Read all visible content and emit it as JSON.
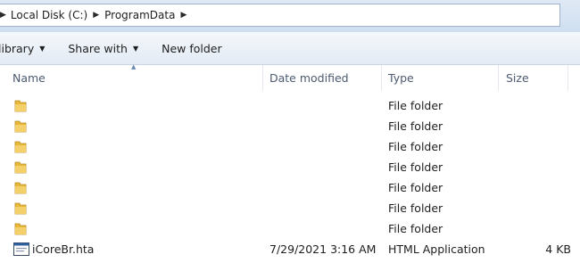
{
  "address": {
    "crumbs": [
      "Local Disk (C:)",
      "ProgramData"
    ]
  },
  "toolbar": {
    "library_label": "library",
    "share_label": "Share with",
    "new_folder_label": "New folder"
  },
  "columns": {
    "name": "Name",
    "date": "Date modified",
    "type": "Type",
    "size": "Size"
  },
  "folders": [
    {
      "type": "File folder"
    },
    {
      "type": "File folder"
    },
    {
      "type": "File folder"
    },
    {
      "type": "File folder"
    },
    {
      "type": "File folder"
    },
    {
      "type": "File folder"
    },
    {
      "type": "File folder"
    }
  ],
  "file": {
    "name": "iCoreBr.hta",
    "date": "7/29/2021 3:16 AM",
    "type": "HTML Application",
    "size": "4 KB"
  },
  "icons": {
    "folder": "folder-icon",
    "file": "hta-file-icon",
    "breadcrumb_arrow": "chevron-right-icon",
    "dropdown": "chevron-down-icon"
  },
  "colors": {
    "folder_yellow": "#e8b83a",
    "header_text": "#4d5b70"
  }
}
